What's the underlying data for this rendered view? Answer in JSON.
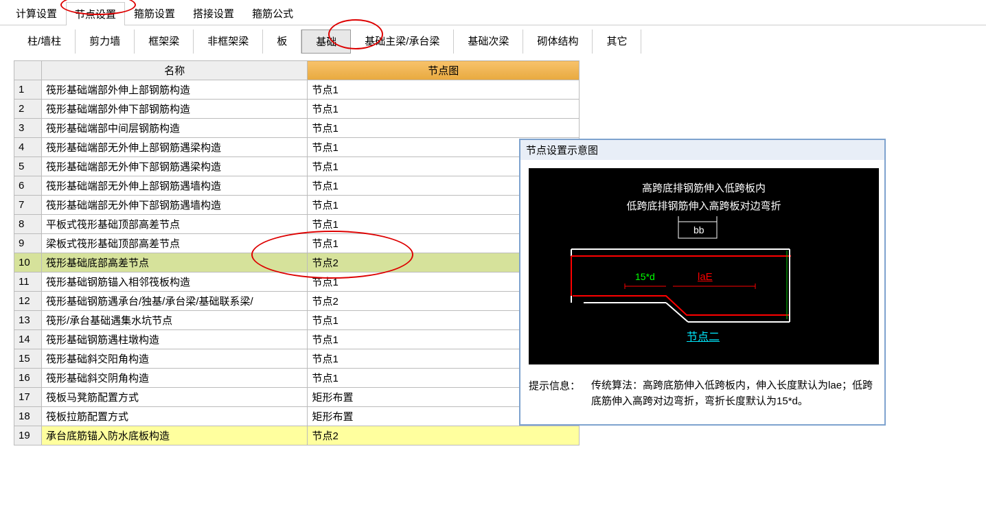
{
  "topTabs": {
    "items": [
      "计算设置",
      "节点设置",
      "箍筋设置",
      "搭接设置",
      "箍筋公式"
    ],
    "activeIndex": 1
  },
  "subTabs": {
    "items": [
      "柱/墙柱",
      "剪力墙",
      "框架梁",
      "非框架梁",
      "板",
      "基础",
      "基础主梁/承台梁",
      "基础次梁",
      "砌体结构",
      "其它"
    ],
    "activeIndex": 5
  },
  "tableHeaders": {
    "name": "名称",
    "node": "节点图"
  },
  "rows": [
    {
      "n": "1",
      "name": "筏形基础端部外伸上部钢筋构造",
      "node": "节点1"
    },
    {
      "n": "2",
      "name": "筏形基础端部外伸下部钢筋构造",
      "node": "节点1"
    },
    {
      "n": "3",
      "name": "筏形基础端部中间层钢筋构造",
      "node": "节点1"
    },
    {
      "n": "4",
      "name": "筏形基础端部无外伸上部钢筋遇梁构造",
      "node": "节点1"
    },
    {
      "n": "5",
      "name": "筏形基础端部无外伸下部钢筋遇梁构造",
      "node": "节点1"
    },
    {
      "n": "6",
      "name": "筏形基础端部无外伸上部钢筋遇墙构造",
      "node": "节点1"
    },
    {
      "n": "7",
      "name": "筏形基础端部无外伸下部钢筋遇墙构造",
      "node": "节点1"
    },
    {
      "n": "8",
      "name": "平板式筏形基础顶部高差节点",
      "node": "节点1"
    },
    {
      "n": "9",
      "name": "梁板式筏形基础顶部高差节点",
      "node": "节点1"
    },
    {
      "n": "10",
      "name": "筏形基础底部高差节点",
      "node": "节点2",
      "hl": true
    },
    {
      "n": "11",
      "name": "筏形基础钢筋锚入相邻筏板构造",
      "node": "节点1"
    },
    {
      "n": "12",
      "name": "筏形基础钢筋遇承台/独基/承台梁/基础联系梁/",
      "node": "节点2"
    },
    {
      "n": "13",
      "name": "筏形/承台基础遇集水坑节点",
      "node": "节点1"
    },
    {
      "n": "14",
      "name": "筏形基础钢筋遇柱墩构造",
      "node": "节点1"
    },
    {
      "n": "15",
      "name": "筏形基础斜交阳角构造",
      "node": "节点1"
    },
    {
      "n": "16",
      "name": "筏形基础斜交阴角构造",
      "node": "节点1"
    },
    {
      "n": "17",
      "name": "筏板马凳筋配置方式",
      "node": "矩形布置"
    },
    {
      "n": "18",
      "name": "筏板拉筋配置方式",
      "node": "矩形布置"
    },
    {
      "n": "19",
      "name": "承台底筋锚入防水底板构造",
      "node": "节点2",
      "yel": true
    }
  ],
  "popup": {
    "title": "节点设置示意图",
    "line1": "高跨底排钢筋伸入低跨板内",
    "line2": "低跨底排钢筋伸入高跨板对边弯折",
    "bb": "bb",
    "dim15d": "15*d",
    "lae": "laE",
    "link": "节点二",
    "hintLabel": "提示信息：",
    "hintText": "传统算法：高跨底筋伸入低跨板内，伸入长度默认为lae；低跨底筋伸入高跨对边弯折，弯折长度默认为15*d。"
  }
}
